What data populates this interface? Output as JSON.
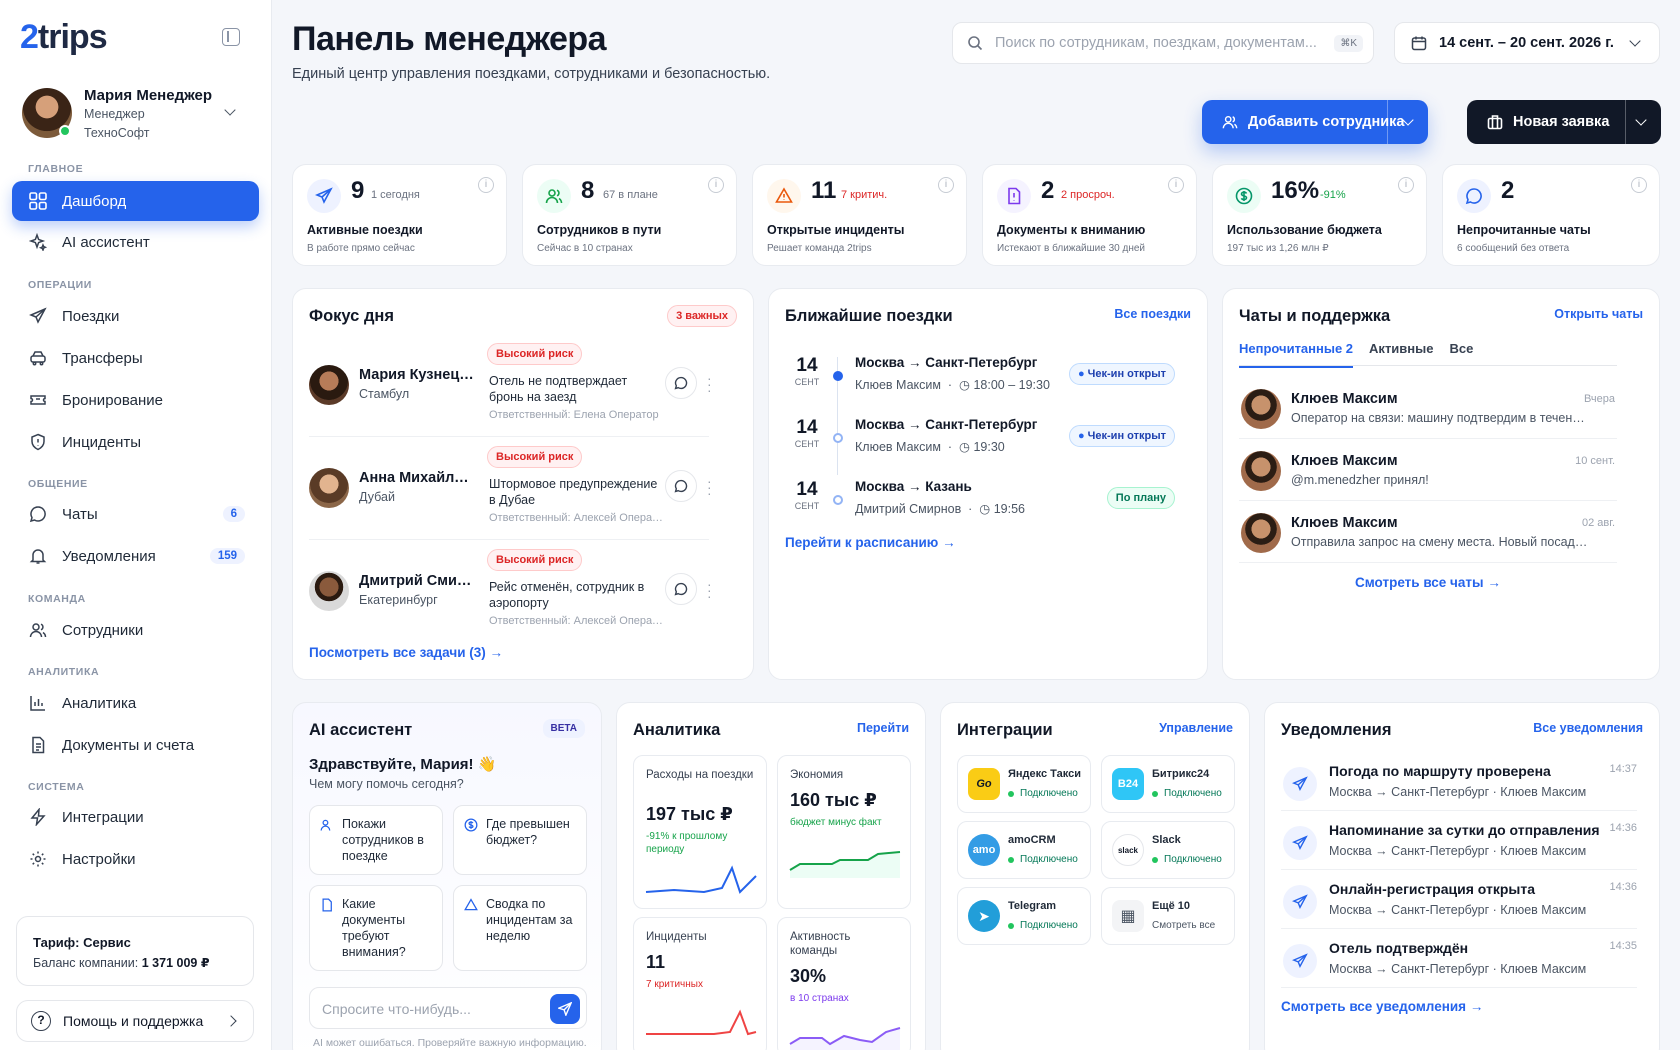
{
  "brand": {
    "logo_num": "2",
    "logo_text": "trips"
  },
  "user": {
    "name": "Мария Менеджер",
    "role": "Менеджер",
    "company": "ТехноСофт"
  },
  "nav": {
    "sec_main": "ГЛАВНОЕ",
    "dashboard": "Дашборд",
    "ai": "AI ассистент",
    "sec_ops": "ОПЕРАЦИИ",
    "trips": "Поездки",
    "transfers": "Трансферы",
    "booking": "Бронирование",
    "incidents": "Инциденты",
    "sec_comm": "ОБЩЕНИЕ",
    "chats": "Чаты",
    "chats_badge": "6",
    "notifications": "Уведомления",
    "notifications_badge": "159",
    "sec_team": "КОМАНДА",
    "employees": "Сотрудники",
    "sec_analytics": "АНАЛИТИКА",
    "analytics": "Аналитика",
    "docs": "Документы и счета",
    "sec_system": "СИСТЕМА",
    "integrations": "Интеграции",
    "settings": "Настройки"
  },
  "tariff": {
    "label": "Тариф: Сервис",
    "balance_label": "Баланс компании:",
    "balance": "1 371 009 ₽"
  },
  "help": "Помощь и поддержка",
  "header": {
    "title": "Панель менеджера",
    "subtitle": "Единый центр управления поездками, сотрудниками и безопасностью.",
    "search_placeholder": "Поиск по сотрудникам, поездкам, документам...",
    "search_kbd": "⌘K",
    "date_range": "14 сент. – 20 сент. 2026 г.",
    "add_employee": "Добавить сотрудника",
    "new_request": "Новая заявка"
  },
  "stats": [
    {
      "num": "9",
      "sub": "1 сегодня",
      "label": "Активные поездки",
      "desc": "В работе прямо сейчас",
      "color": "#2563eb",
      "sub_color": "#6b7280"
    },
    {
      "num": "8",
      "sub": "67 в плане",
      "label": "Сотрудников в пути",
      "desc": "Сейчас в 10 странах",
      "color": "#16a34a",
      "sub_color": "#6b7280"
    },
    {
      "num": "11",
      "sub": "7 критич.",
      "label": "Открытые инциденты",
      "desc": "Решает команда 2trips",
      "color": "#ea580c",
      "sub_color": "#dc2626"
    },
    {
      "num": "2",
      "sub": "2 просроч.",
      "label": "Документы к вниманию",
      "desc": "Истекают в ближайшие 30 дней",
      "color": "#7c3aed",
      "sub_color": "#dc2626"
    },
    {
      "num": "16%",
      "sub": "-91%",
      "label": "Использование бюджета",
      "desc": "197 тыс из 1,26 млн ₽",
      "color": "#059669",
      "sub_color": "#16a34a"
    },
    {
      "num": "2",
      "sub": "",
      "label": "Непрочитанные чаты",
      "desc": "6 сообщений без ответа",
      "color": "#2563eb",
      "sub_color": "#6b7280"
    }
  ],
  "focus": {
    "title": "Фокус дня",
    "badge": "3 важных",
    "rows": [
      {
        "name": "Мария Кузнецова",
        "city": "Стамбул",
        "risk": "Высокий риск",
        "text": "Отель не подтверждает бронь на заезд",
        "resp": "Ответственный: Елена Оператор"
      },
      {
        "name": "Анна Михайлова",
        "city": "Дубай",
        "risk": "Высокий риск",
        "text": "Штормовое предупреждение в Дубае",
        "resp": "Ответственный: Алексей Оператор"
      },
      {
        "name": "Дмитрий Смирнов",
        "city": "Екатеринбург",
        "risk": "Высокий риск",
        "text": "Рейс отменён, сотрудник в аэропорту",
        "resp": "Ответственный: Алексей Оператор"
      }
    ],
    "link": "Посмотреть все задачи (3)"
  },
  "trips": {
    "title": "Ближайшие поездки",
    "link_all": "Все поездки",
    "rows": [
      {
        "day": "14",
        "month": "СЕНТ",
        "route": "Москва → Санкт-Петербург",
        "who": "Клюев Максим",
        "time": "18:00 – 19:30",
        "status": "Чек-ин открыт"
      },
      {
        "day": "14",
        "month": "СЕНТ",
        "route": "Москва → Санкт-Петербург",
        "who": "Клюев Максим",
        "time": "19:30",
        "status": "Чек-ин открыт"
      },
      {
        "day": "14",
        "month": "СЕНТ",
        "route": "Москва → Казань",
        "who": "Дмитрий Смирнов",
        "time": "19:56",
        "status": "По плану"
      }
    ],
    "link_schedule": "Перейти к расписанию"
  },
  "chats": {
    "title": "Чаты и поддержка",
    "link_open": "Открыть чаты",
    "tab_unread": "Непрочитанные 2",
    "tab_active": "Активные",
    "tab_all": "Все",
    "rows": [
      {
        "name": "Клюев Максим",
        "msg": "Оператор на связи: машину подтвердим в течение 10 минут",
        "time": "Вчера"
      },
      {
        "name": "Клюев Максим",
        "msg": "@m.menedzher принял!",
        "time": "10 сент."
      },
      {
        "name": "Клюев Максим",
        "msg": "Отправила запрос на смену места. Новый посадочный пришлём",
        "time": "02 авг."
      }
    ],
    "link_all": "Смотреть все чаты"
  },
  "ai": {
    "title": "AI ассистент",
    "beta": "BETA",
    "greeting": "Здравствуйте, Мария! 👋",
    "prompt": "Чем могу помочь сегодня?",
    "suggestions": [
      "Покажи сотрудников в поездке",
      "Где превышен бюджет?",
      "Какие документы требуют внимания?",
      "Сводка по инцидентам за неделю"
    ],
    "placeholder": "Спросите что-нибудь...",
    "disclaimer": "AI может ошибаться. Проверяйте важную информацию."
  },
  "analytics": {
    "title": "Аналитика",
    "link": "Перейти",
    "cards": [
      {
        "label": "Расходы на поездки",
        "value": "197 тыс ₽",
        "sub": "-91% к прошлому периоду",
        "color": "#16a34a",
        "line": "#2563eb"
      },
      {
        "label": "Экономия",
        "value": "160 тыс ₽",
        "sub": "бюджет минус факт",
        "color": "#16a34a",
        "line": "#16a34a"
      },
      {
        "label": "Инциденты",
        "value": "11",
        "sub": "7 критичных",
        "color": "#dc2626",
        "line": "#ef4444"
      },
      {
        "label": "Активность команды",
        "value": "30%",
        "sub": "в 10 странах",
        "color": "#7c3aed",
        "line": "#8b5cf6"
      }
    ]
  },
  "integrations": {
    "title": "Интеграции",
    "link": "Управление",
    "items": [
      {
        "name": "Яндекс Такси",
        "status": "Подключено",
        "logo": "Go",
        "color": "#facc15"
      },
      {
        "name": "Битрикс24",
        "status": "Подключено",
        "logo": "B24",
        "color": "#2fc6f6"
      },
      {
        "name": "amoCRM",
        "status": "Подключено",
        "logo": "amo",
        "color": "#339ce5"
      },
      {
        "name": "Slack",
        "status": "Подключено",
        "logo": "slack",
        "color": "#ffffff"
      },
      {
        "name": "Telegram",
        "status": "Подключено",
        "logo": "➤",
        "color": "#229ed9"
      },
      {
        "name": "Ещё 10",
        "status": "Смотреть все",
        "logo": "▦",
        "color": "#f3f4f6"
      }
    ]
  },
  "notifications": {
    "title": "Уведомления",
    "link": "Все уведомления",
    "rows": [
      {
        "title": "Погода по маршруту проверена",
        "desc": "Москва → Санкт-Петербург · Клюев Максим",
        "time": "14:37"
      },
      {
        "title": "Напоминание за сутки до отправления",
        "desc": "Москва → Санкт-Петербург · Клюев Максим",
        "time": "14:36"
      },
      {
        "title": "Онлайн-регистрация открыта",
        "desc": "Москва → Санкт-Петербург · Клюев Максим",
        "time": "14:36"
      },
      {
        "title": "Отель подтверждён",
        "desc": "Москва → Санкт-Петербург · Клюев Максим",
        "time": "14:35"
      }
    ],
    "link_all": "Смотреть все уведомления"
  }
}
